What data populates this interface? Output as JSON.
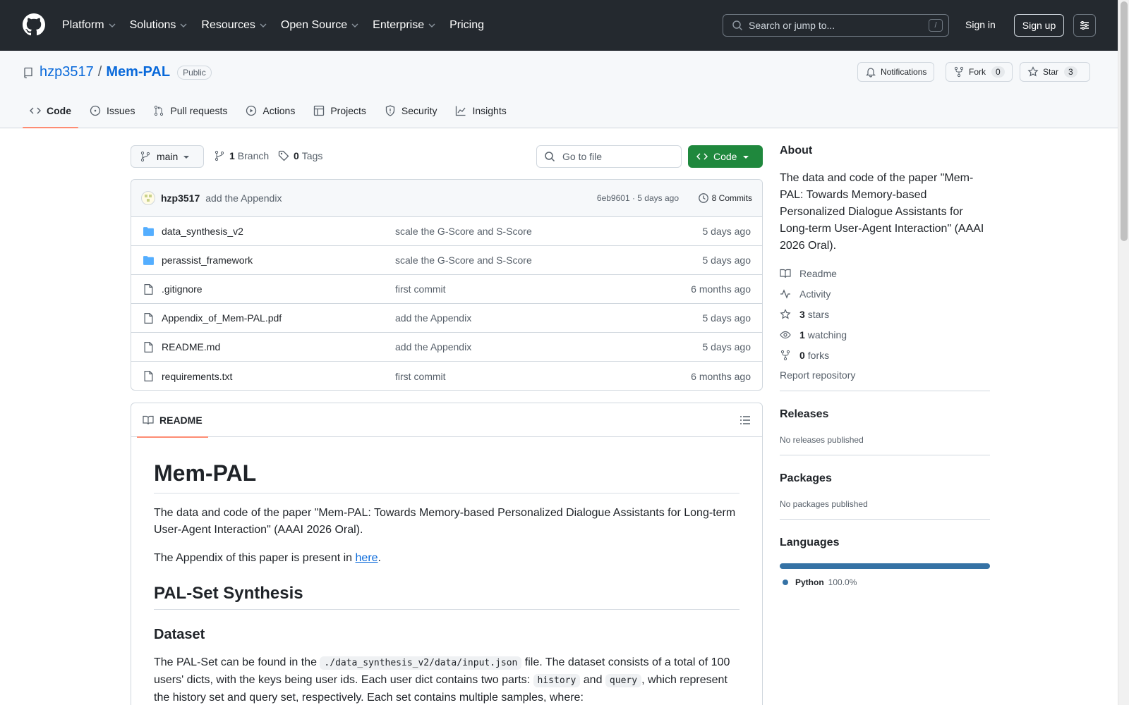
{
  "header": {
    "nav": [
      "Platform",
      "Solutions",
      "Resources",
      "Open Source",
      "Enterprise",
      "Pricing"
    ],
    "search_placeholder": "Search or jump to...",
    "search_key": "/",
    "signin": "Sign in",
    "signup": "Sign up"
  },
  "repo": {
    "owner": "hzp3517",
    "separator": "/",
    "name": "Mem-PAL",
    "visibility": "Public",
    "notifications": "Notifications",
    "fork_label": "Fork",
    "fork_count": "0",
    "star_label": "Star",
    "star_count": "3",
    "tabs": [
      "Code",
      "Issues",
      "Pull requests",
      "Actions",
      "Projects",
      "Security",
      "Insights"
    ]
  },
  "toolbar": {
    "branch": "main",
    "branch_count": "1",
    "branch_label": "Branch",
    "tag_count": "0",
    "tag_label": "Tags",
    "goto_placeholder": "Go to file",
    "code_button": "Code"
  },
  "commit": {
    "author": "hzp3517",
    "message": "add the Appendix",
    "meta": "6eb9601 · 5 days ago",
    "commits": "8 Commits"
  },
  "files": [
    {
      "type": "dir",
      "name": "data_synthesis_v2",
      "message": "scale the G-Score and S-Score",
      "date": "5 days ago"
    },
    {
      "type": "dir",
      "name": "perassist_framework",
      "message": "scale the G-Score and S-Score",
      "date": "5 days ago"
    },
    {
      "type": "file",
      "name": ".gitignore",
      "message": "first commit",
      "date": "6 months ago"
    },
    {
      "type": "file",
      "name": "Appendix_of_Mem-PAL.pdf",
      "message": "add the Appendix",
      "date": "5 days ago"
    },
    {
      "type": "file",
      "name": "README.md",
      "message": "add the Appendix",
      "date": "5 days ago"
    },
    {
      "type": "file",
      "name": "requirements.txt",
      "message": "first commit",
      "date": "6 months ago"
    }
  ],
  "readme": {
    "tab": "README",
    "title": "Mem-PAL",
    "intro": "The data and code of the paper \"Mem-PAL: Towards Memory-based Personalized Dialogue Assistants for Long-term User-Agent Interaction\" (AAAI 2026 Oral).",
    "appendix_before": "The Appendix of this paper is present in ",
    "appendix_link": "here",
    "appendix_after": ".",
    "h2": "PAL-Set Synthesis",
    "h3": "Dataset",
    "p1_a": "The PAL-Set can be found in the ",
    "p1_code": "./data_synthesis_v2/data/input.json",
    "p1_b": " file. The dataset consists of a total of 100 users' dicts, with the keys being user ids. Each user dict contains two parts: ",
    "p1_code2": "history",
    "p1_c": " and ",
    "p1_code3": "query",
    "p1_d": ", which represent the history set and query set, respectively. Each set contains multiple samples, where:"
  },
  "sidebar": {
    "about_title": "About",
    "about_text": "The data and code of the paper \"Mem-PAL: Towards Memory-based Personalized Dialogue Assistants for Long-term User-Agent Interaction\" (AAAI 2026 Oral).",
    "readme": "Readme",
    "activity": "Activity",
    "stars_count": "3",
    "stars_label": "stars",
    "watching_count": "1",
    "watching_label": "watching",
    "forks_count": "0",
    "forks_label": "forks",
    "report": "Report repository",
    "releases_title": "Releases",
    "releases_text": "No releases published",
    "packages_title": "Packages",
    "packages_text": "No packages published",
    "languages_title": "Languages",
    "language_name": "Python",
    "language_pct": "100.0%",
    "language_share": 100.0,
    "language_color": "#3572A5"
  },
  "colors": {
    "header_bg": "#24292f",
    "accent_link": "#0969da",
    "code_button": "#1f883d",
    "tab_underline": "#fd8c73"
  }
}
